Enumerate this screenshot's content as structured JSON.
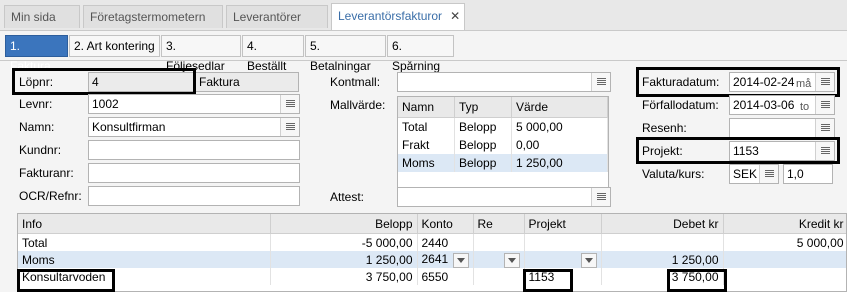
{
  "top_tabs": [
    "Min sida",
    "Företagstermometern",
    "Leverantörer",
    "Leverantörsfakturor"
  ],
  "close_glyph": "✕",
  "sub_tabs": [
    "1. Faktura",
    "2. Art kontering",
    "3. Följesedlar",
    "4. Beställt",
    "5. Betalningar",
    "6. Spårning"
  ],
  "left": {
    "lopnr_label": "Löpnr:",
    "lopnr_value": "4",
    "lopnr_type": "Faktura",
    "levnr_label": "Levnr:",
    "levnr_value": "1002",
    "namn_label": "Namn:",
    "namn_value": "Konsultfirman",
    "kundnr_label": "Kundnr:",
    "kundnr_value": "",
    "fakturanr_label": "Fakturanr:",
    "fakturanr_value": "",
    "ocr_label": "OCR/Refnr:",
    "ocr_value": ""
  },
  "middle": {
    "kontmall_label": "Kontmall:",
    "kontmall_value": "",
    "mallvarde_label": "Mallvärde:",
    "attest_label": "Attest:",
    "attest_value": "",
    "mall_headers": [
      "Namn",
      "Typ",
      "Värde"
    ],
    "mall_rows": [
      [
        "Total",
        "Belopp",
        "5 000,00"
      ],
      [
        "Frakt",
        "Belopp",
        "0,00"
      ],
      [
        "Moms",
        "Belopp",
        "1 250,00"
      ]
    ]
  },
  "right": {
    "fakturadatum_label": "Fakturadatum:",
    "fakturadatum_value": "2014-02-24",
    "fakturadatum_suffix": "må",
    "forfallodatum_label": "Förfallodatum:",
    "forfallodatum_value": "2014-03-06",
    "forfallodatum_suffix": "to",
    "resenh_label": "Resenh:",
    "resenh_value": "",
    "projekt_label": "Projekt:",
    "projekt_value": "1153",
    "valuta_label": "Valuta/kurs:",
    "valuta_value": "SEK",
    "kurs_value": "1,0"
  },
  "grid": {
    "headers": [
      "Info",
      "Belopp",
      "Konto",
      "Re",
      "Projekt",
      "Debet kr",
      "Kredit kr"
    ],
    "rows": [
      [
        "Total",
        "-5 000,00",
        "2440",
        "",
        "",
        "",
        "5 000,00"
      ],
      [
        "Moms",
        "1 250,00",
        "2641",
        "",
        "",
        "1 250,00",
        ""
      ],
      [
        "Konsultarvoden",
        "3 750,00",
        "6550",
        "",
        "1153",
        "3 750,00",
        ""
      ]
    ]
  }
}
